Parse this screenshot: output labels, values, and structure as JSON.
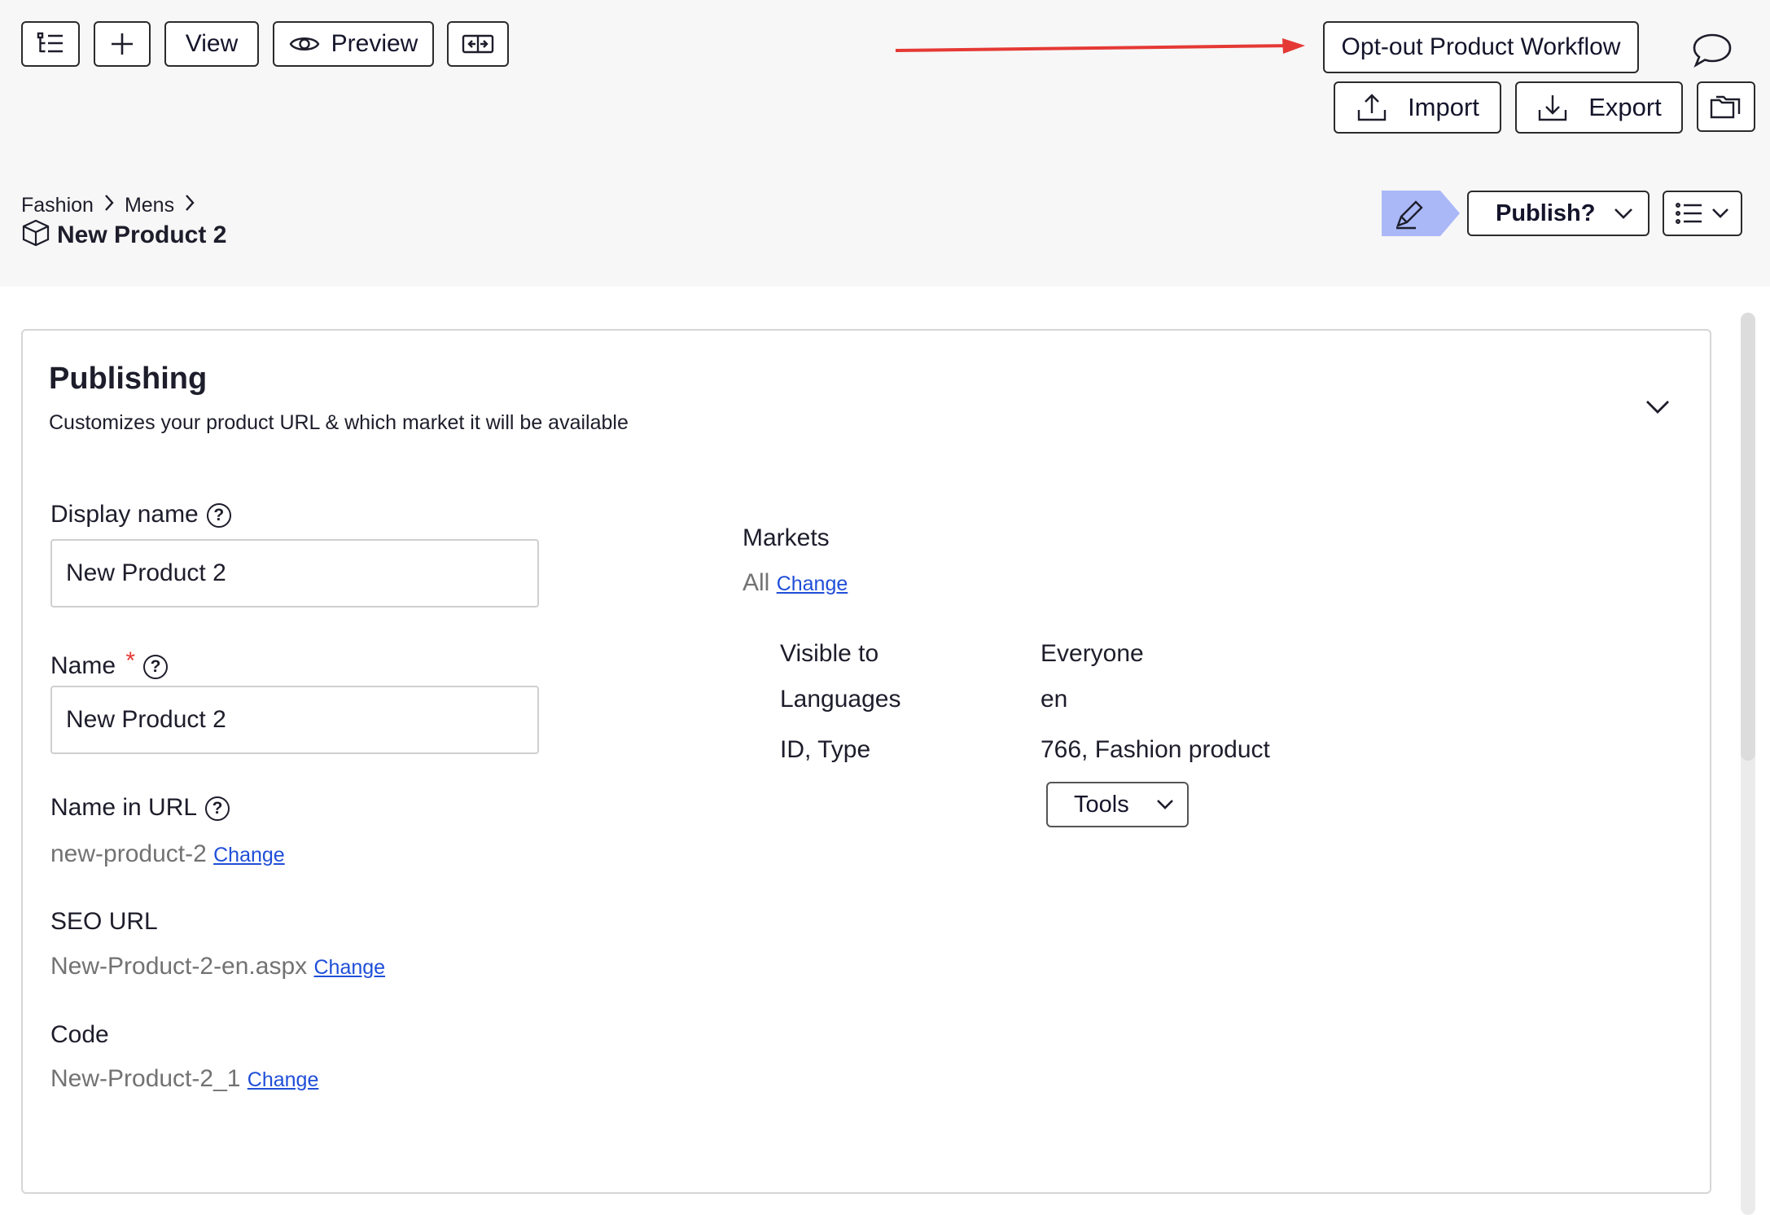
{
  "toolbar": {
    "view_label": "View",
    "preview_label": "Preview",
    "opt_out_label": "Opt-out Product Workflow",
    "import_label": "Import",
    "export_label": "Export",
    "annotation_color": "#e53935"
  },
  "breadcrumb": {
    "items": [
      "Fashion",
      "Mens"
    ],
    "title": "New Product 2"
  },
  "actions": {
    "publish_label": "Publish?",
    "edit_badge_color": "#aab8f8"
  },
  "publishing": {
    "title": "Publishing",
    "subtitle": "Customizes your product URL & which market it will be available",
    "display_name_label": "Display name",
    "display_name_value": "New Product 2",
    "name_label": "Name",
    "required_mark": "*",
    "name_value": "New Product 2",
    "name_in_url_label": "Name in URL",
    "name_in_url_value": "new-product-2",
    "seo_url_label": "SEO URL",
    "seo_url_value": "New-Product-2-en.aspx",
    "code_label": "Code",
    "code_value": "New-Product-2_1",
    "change_link": "Change",
    "markets_label": "Markets",
    "markets_value": "All",
    "visible_to_label": "Visible to",
    "visible_to_value": "Everyone",
    "languages_label": "Languages",
    "languages_value": "en",
    "id_type_label": "ID, Type",
    "id_type_value": "766, Fashion product",
    "tools_label": "Tools"
  }
}
